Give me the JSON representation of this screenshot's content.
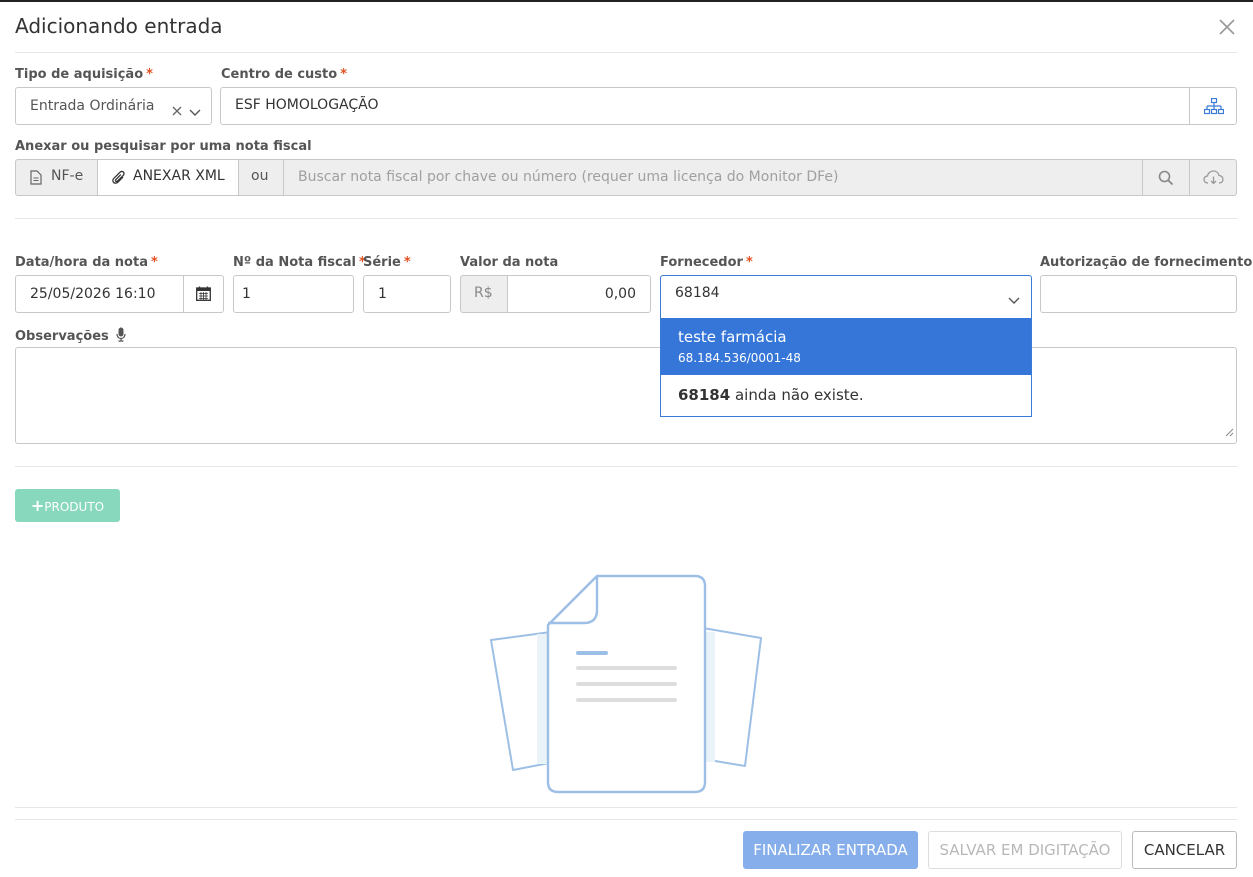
{
  "modal": {
    "title": "Adicionando entrada"
  },
  "form": {
    "tipo_aquisicao": {
      "label": "Tipo de aquisição",
      "value": "Entrada Ordinária"
    },
    "centro_custo": {
      "label": "Centro de custo",
      "value": "ESF HOMOLOGAÇÃO"
    },
    "nota_fiscal_section": {
      "label": "Anexar ou pesquisar por uma nota fiscal",
      "nfe_label": "NF-e",
      "attach_label": "ANEXAR XML",
      "ou_label": "ou",
      "search_placeholder": "Buscar nota fiscal por chave ou número (requer uma licença do Monitor DFe)"
    },
    "data_hora": {
      "label": "Data/hora da nota",
      "value": "25/05/2026 16:10"
    },
    "numero_nota": {
      "label": "Nº da Nota fiscal",
      "value": "1"
    },
    "serie": {
      "label": "Série",
      "value": "1"
    },
    "valor_nota": {
      "label": "Valor da nota",
      "prefix": "R$",
      "value": "0,00"
    },
    "fornecedor": {
      "label": "Fornecedor",
      "value": "68184",
      "options": [
        {
          "name": "teste farmácia",
          "doc": "68.184.536/0001-48"
        }
      ],
      "not_exists_term": "68184",
      "not_exists_text": "ainda não existe."
    },
    "autorizacao": {
      "label": "Autorização de fornecimento",
      "value": ""
    },
    "observacoes": {
      "label": "Observações",
      "value": ""
    }
  },
  "products": {
    "add_label": "PRODUTO"
  },
  "footer": {
    "finalizar_label": "FINALIZAR ENTRADA",
    "salvar_label": "SALVAR EM DIGITAÇÃO",
    "cancelar_label": "CANCELAR"
  },
  "colors": {
    "primary": "#3576d8",
    "primary_disabled": "#86aeea",
    "success_disabled": "#88d8bd",
    "required": "#e05020"
  },
  "icons": [
    "close-icon",
    "clear-icon",
    "chevron-down-icon",
    "org-chart-icon",
    "file-icon",
    "paperclip-icon",
    "search-icon",
    "cloud-download-icon",
    "calendar-icon",
    "microphone-icon",
    "plus-icon",
    "empty-document-illustration"
  ]
}
